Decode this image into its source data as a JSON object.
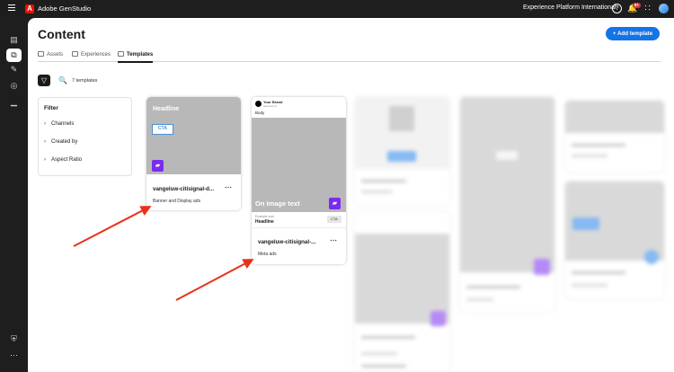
{
  "app": {
    "name": "Adobe GenStudio",
    "org": "Experience Platform International",
    "notification_badge": "9+"
  },
  "page": {
    "title": "Content",
    "add_button": "Add template"
  },
  "tabs": [
    {
      "label": "Assets",
      "selected": false
    },
    {
      "label": "Experiences",
      "selected": false
    },
    {
      "label": "Templates",
      "selected": true
    }
  ],
  "toolbar": {
    "count": "7 templates"
  },
  "filter": {
    "title": "Filter",
    "items": [
      "Channels",
      "Created by",
      "Aspect Ratio"
    ]
  },
  "cards": [
    {
      "preview_headline": "Headline",
      "preview_cta": "CTA",
      "name": "vangeluw-citisignal-d...",
      "type": "Banner and Display ads"
    },
    {
      "preview_brand": "Your Brand",
      "preview_sponsored": "Sponsored",
      "preview_body": "Body",
      "preview_image_text": "On Image text",
      "preview_url": "Example.com",
      "preview_headline": "Headline",
      "preview_cta": "CTA",
      "name": "vangeluw-citisignal-...",
      "type": "Meta ads"
    }
  ],
  "colors": {
    "accent": "#1473e6",
    "purple": "#7b2cf0",
    "arrow": "#e8311a"
  }
}
